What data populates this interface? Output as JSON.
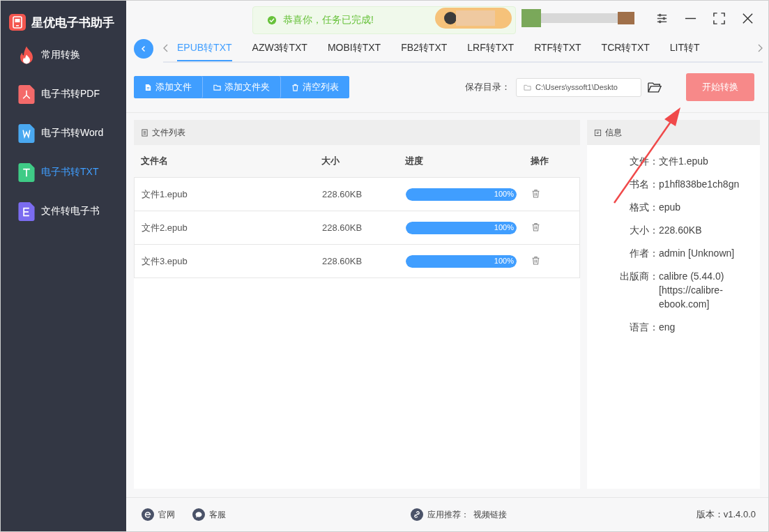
{
  "app": {
    "title": "星优电子书助手"
  },
  "sidebar": {
    "items": [
      {
        "label": "常用转换",
        "kind": "fire",
        "selected": false
      },
      {
        "label": "电子书转PDF",
        "kind": "pdf",
        "selected": false
      },
      {
        "label": "电子书转Word",
        "kind": "word",
        "selected": false
      },
      {
        "label": "电子书转TXT",
        "kind": "txt",
        "selected": true
      },
      {
        "label": "文件转电子书",
        "kind": "ebook",
        "selected": false
      }
    ]
  },
  "toast": {
    "message": "恭喜你，任务已完成!"
  },
  "tabs": [
    {
      "label": "EPUB转TXT",
      "selected": true
    },
    {
      "label": "AZW3转TXT",
      "selected": false
    },
    {
      "label": "MOBI转TXT",
      "selected": false
    },
    {
      "label": "FB2转TXT",
      "selected": false
    },
    {
      "label": "LRF转TXT",
      "selected": false
    },
    {
      "label": "RTF转TXT",
      "selected": false
    },
    {
      "label": "TCR转TXT",
      "selected": false
    },
    {
      "label": "LIT转T",
      "selected": false
    }
  ],
  "toolbar": {
    "buttons": [
      {
        "label": "添加文件",
        "kind": "file"
      },
      {
        "label": "添加文件夹",
        "kind": "folder"
      },
      {
        "label": "清空列表",
        "kind": "clear"
      }
    ],
    "save_dir_label": "保存目录：",
    "save_dir": "C:\\Users\\yssoft1\\Deskto",
    "start_button": "开始转换"
  },
  "file_list": {
    "title": "文件列表",
    "columns": [
      "文件名",
      "大小",
      "进度",
      "操作"
    ],
    "rows": [
      {
        "name": "文件1.epub",
        "size": "228.60KB",
        "level": 1,
        "reading": "100%"
      },
      {
        "name": "文件2.epub",
        "size": "228.60KB",
        "level": 1,
        "reading": "100%"
      },
      {
        "name": "文件3.epub",
        "size": "228.60KB",
        "level": 1,
        "reading": "100%"
      }
    ]
  },
  "info": {
    "title": "信息",
    "fields": [
      {
        "label": "文件：",
        "value": "文件1.epub"
      },
      {
        "label": "书名：",
        "value": "p1hfl838be1ch8gn"
      },
      {
        "label": "格式：",
        "value": "epub"
      },
      {
        "label": "大小：",
        "value": "228.60KB"
      },
      {
        "label": "作者：",
        "value": "admin [Unknown]"
      },
      {
        "label": "出版商：",
        "value": "calibre (5.44.0) [https://calibre-ebook.com]"
      },
      {
        "label": "语言：",
        "value": "eng"
      }
    ]
  },
  "footer": {
    "links": [
      {
        "label": "官网",
        "kind": "web"
      },
      {
        "label": "客服",
        "kind": "chat"
      }
    ],
    "recommend_label": "应用推荐：",
    "recommend_link": "视频链接",
    "version": "版本：v1.4.0.0"
  }
}
